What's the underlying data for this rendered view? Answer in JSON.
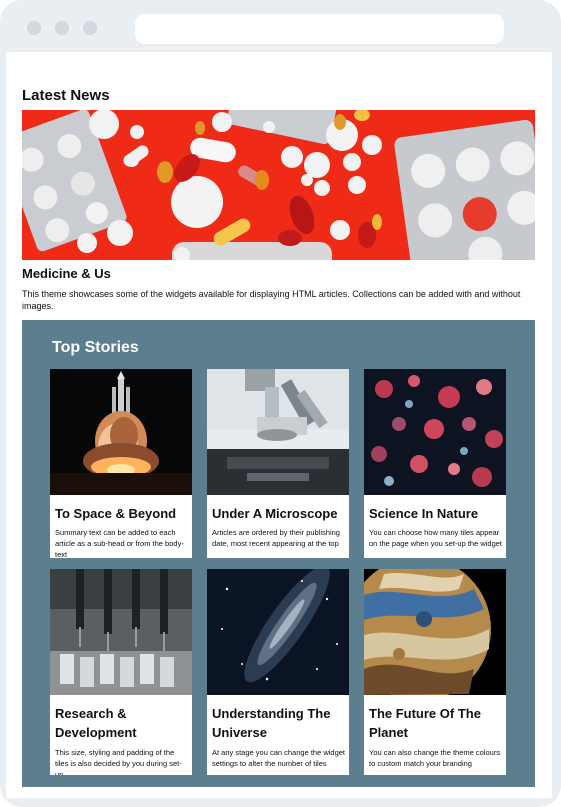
{
  "news": {
    "heading": "Latest News",
    "article_title": "Medicine & Us",
    "article_desc": "This theme showcases some of the widgets available for displaying HTML articles. Collections can be added with and without images."
  },
  "top_stories": {
    "title": "Top Stories",
    "tiles": [
      {
        "title": "To Space & Beyond",
        "summary": "Summary text can be added to each article as a sub-head or from the body-text",
        "icon": "rocket-launch-image"
      },
      {
        "title": "Under A Microscope",
        "summary": "Articles are ordered by their publishing date, most recent appearing at the top",
        "icon": "microscope-image"
      },
      {
        "title": "Science In Nature",
        "summary": "You can choose how many tiles appear on the page when you set-up the widget",
        "icon": "jellyfish-image"
      },
      {
        "title": "Research & Development",
        "summary": "This size, styling and padding of the tiles is also decided by you during set-up",
        "icon": "lab-pipette-image"
      },
      {
        "title": "Understanding The Universe",
        "summary": "At any stage you can change the widget settings to alter the number of tiles",
        "icon": "galaxy-image"
      },
      {
        "title": "The Future Of The Planet",
        "summary": "You can also change the theme colours to custom match your branding",
        "icon": "planet-image"
      }
    ]
  },
  "colors": {
    "frame": "#e9eef3",
    "hero_red": "#ef2a16",
    "top_stories_bg": "#5b7f8f"
  }
}
